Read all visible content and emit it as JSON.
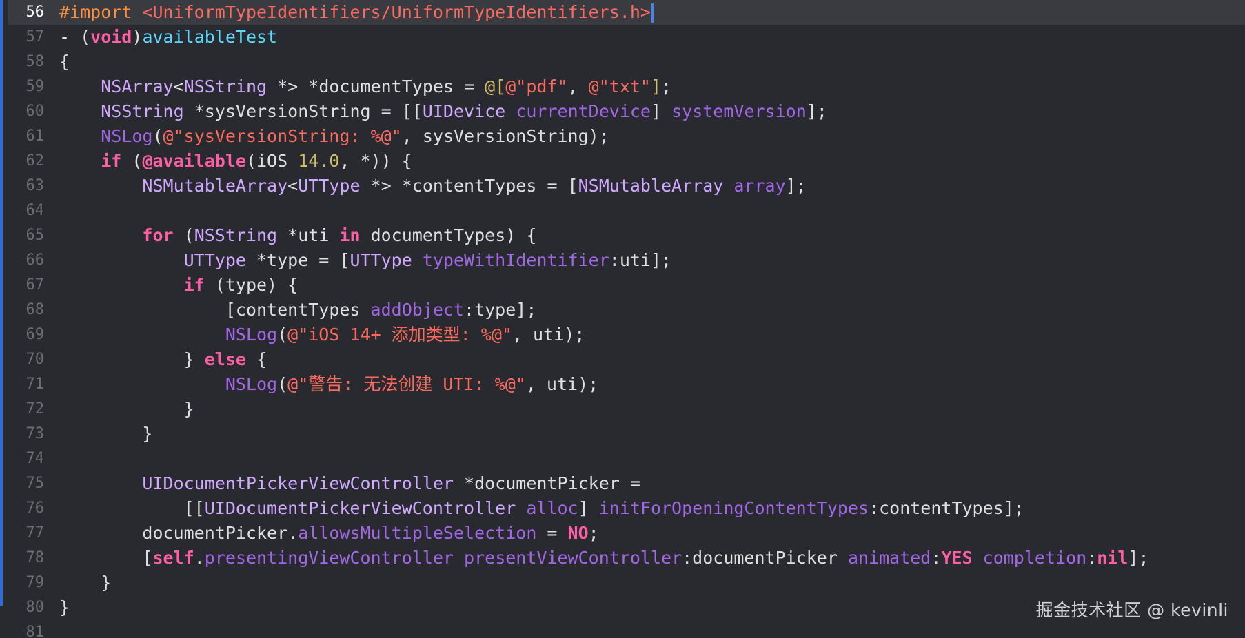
{
  "editor": {
    "current_line": "56",
    "watermark": "掘金技术社区 @ kevinli",
    "lines": [
      {
        "n": "56",
        "segments": [
          [
            "pre",
            "#import "
          ],
          [
            "str",
            "<UniformTypeIdentifiers/UniformTypeIdentifiers.h>"
          ]
        ]
      },
      {
        "n": "57",
        "segments": [
          [
            "",
            "- ("
          ],
          [
            "kw",
            "void"
          ],
          [
            "",
            ")"
          ],
          [
            "cls",
            "availableTest"
          ]
        ]
      },
      {
        "n": "58",
        "segments": [
          [
            "",
            "{"
          ]
        ]
      },
      {
        "n": "59",
        "segments": [
          [
            "",
            "    "
          ],
          [
            "type",
            "NSArray"
          ],
          [
            "",
            "<"
          ],
          [
            "type",
            "NSString"
          ],
          [
            "",
            " *> *documentTypes = "
          ],
          [
            "num",
            "@["
          ],
          [
            "str",
            "@\"pdf\""
          ],
          [
            "",
            ", "
          ],
          [
            "str",
            "@\"txt\""
          ],
          [
            "num",
            "]"
          ],
          [
            "",
            ";"
          ]
        ]
      },
      {
        "n": "60",
        "segments": [
          [
            "",
            "    "
          ],
          [
            "type",
            "NSString"
          ],
          [
            "",
            " *sysVersionString = [["
          ],
          [
            "type",
            "UIDevice"
          ],
          [
            "",
            " "
          ],
          [
            "meth",
            "currentDevice"
          ],
          [
            "",
            "] "
          ],
          [
            "meth",
            "systemVersion"
          ],
          [
            "",
            "];"
          ]
        ]
      },
      {
        "n": "61",
        "segments": [
          [
            "",
            "    "
          ],
          [
            "meth",
            "NSLog"
          ],
          [
            "",
            "("
          ],
          [
            "str",
            "@\"sysVersionString: %@\""
          ],
          [
            "",
            ", sysVersionString);"
          ]
        ]
      },
      {
        "n": "62",
        "segments": [
          [
            "",
            "    "
          ],
          [
            "kw",
            "if"
          ],
          [
            "",
            " ("
          ],
          [
            "kw",
            "@available"
          ],
          [
            "",
            "(iOS "
          ],
          [
            "num",
            "14.0"
          ],
          [
            "",
            ", *)) {"
          ]
        ]
      },
      {
        "n": "63",
        "segments": [
          [
            "",
            "        "
          ],
          [
            "type",
            "NSMutableArray"
          ],
          [
            "",
            "<"
          ],
          [
            "type",
            "UTType"
          ],
          [
            "",
            " *> *contentTypes = ["
          ],
          [
            "type",
            "NSMutableArray"
          ],
          [
            "",
            " "
          ],
          [
            "meth",
            "array"
          ],
          [
            "",
            "];"
          ]
        ]
      },
      {
        "n": "64",
        "segments": [
          [
            "",
            ""
          ]
        ]
      },
      {
        "n": "65",
        "segments": [
          [
            "",
            "        "
          ],
          [
            "kw",
            "for"
          ],
          [
            "",
            " ("
          ],
          [
            "type",
            "NSString"
          ],
          [
            "",
            " *uti "
          ],
          [
            "kw",
            "in"
          ],
          [
            "",
            " documentTypes) {"
          ]
        ]
      },
      {
        "n": "66",
        "segments": [
          [
            "",
            "            "
          ],
          [
            "type",
            "UTType"
          ],
          [
            "",
            " *type = ["
          ],
          [
            "type",
            "UTType"
          ],
          [
            "",
            " "
          ],
          [
            "meth",
            "typeWithIdentifier"
          ],
          [
            "",
            ":uti];"
          ]
        ]
      },
      {
        "n": "67",
        "segments": [
          [
            "",
            "            "
          ],
          [
            "kw",
            "if"
          ],
          [
            "",
            " (type) {"
          ]
        ]
      },
      {
        "n": "68",
        "segments": [
          [
            "",
            "                [contentTypes "
          ],
          [
            "meth",
            "addObject"
          ],
          [
            "",
            ":type];"
          ]
        ]
      },
      {
        "n": "69",
        "segments": [
          [
            "",
            "                "
          ],
          [
            "meth",
            "NSLog"
          ],
          [
            "",
            "("
          ],
          [
            "str",
            "@\"iOS 14+ 添加类型: %@\""
          ],
          [
            "",
            ", uti);"
          ]
        ]
      },
      {
        "n": "70",
        "segments": [
          [
            "",
            "            } "
          ],
          [
            "kw",
            "else"
          ],
          [
            "",
            " {"
          ]
        ]
      },
      {
        "n": "71",
        "segments": [
          [
            "",
            "                "
          ],
          [
            "meth",
            "NSLog"
          ],
          [
            "",
            "("
          ],
          [
            "str",
            "@\"警告: 无法创建 UTI: %@\""
          ],
          [
            "",
            ", uti);"
          ]
        ]
      },
      {
        "n": "72",
        "segments": [
          [
            "",
            "            }"
          ]
        ]
      },
      {
        "n": "73",
        "segments": [
          [
            "",
            "        }"
          ]
        ]
      },
      {
        "n": "74",
        "segments": [
          [
            "",
            ""
          ]
        ]
      },
      {
        "n": "75",
        "segments": [
          [
            "",
            "        "
          ],
          [
            "type",
            "UIDocumentPickerViewController"
          ],
          [
            "",
            " *documentPicker ="
          ]
        ]
      },
      {
        "n": "76",
        "segments": [
          [
            "",
            "            [["
          ],
          [
            "type",
            "UIDocumentPickerViewController"
          ],
          [
            "",
            " "
          ],
          [
            "meth",
            "alloc"
          ],
          [
            "",
            "] "
          ],
          [
            "meth",
            "initForOpeningContentTypes"
          ],
          [
            "",
            ":contentTypes];"
          ]
        ]
      },
      {
        "n": "77",
        "segments": [
          [
            "",
            "        documentPicker."
          ],
          [
            "meth",
            "allowsMultipleSelection"
          ],
          [
            "",
            " = "
          ],
          [
            "kw",
            "NO"
          ],
          [
            "",
            ";"
          ]
        ]
      },
      {
        "n": "78",
        "segments": [
          [
            "",
            "        ["
          ],
          [
            "kw",
            "self"
          ],
          [
            "",
            "."
          ],
          [
            "meth",
            "presentingViewController"
          ],
          [
            "",
            " "
          ],
          [
            "meth",
            "presentViewController"
          ],
          [
            "",
            ":documentPicker "
          ],
          [
            "meth",
            "animated"
          ],
          [
            "",
            ":"
          ],
          [
            "kw",
            "YES"
          ],
          [
            "",
            " "
          ],
          [
            "meth",
            "completion"
          ],
          [
            "",
            ":"
          ],
          [
            "kw",
            "nil"
          ],
          [
            "",
            "];"
          ]
        ]
      },
      {
        "n": "79",
        "segments": [
          [
            "",
            "    }"
          ]
        ]
      },
      {
        "n": "80",
        "segments": [
          [
            "",
            "}"
          ]
        ]
      },
      {
        "n": "81",
        "segments": [
          [
            "",
            ""
          ]
        ]
      }
    ]
  },
  "colors": {
    "background": "#292a30",
    "current_line": "#3a3b41",
    "keyword": "#fc5fa3",
    "preprocessor": "#fd8f3f",
    "string": "#fc6a5d",
    "number": "#d0bf69",
    "type": "#d0a8ff",
    "method": "#a167e6",
    "declaration": "#5dd8ff",
    "caret": "#3d84ff"
  }
}
